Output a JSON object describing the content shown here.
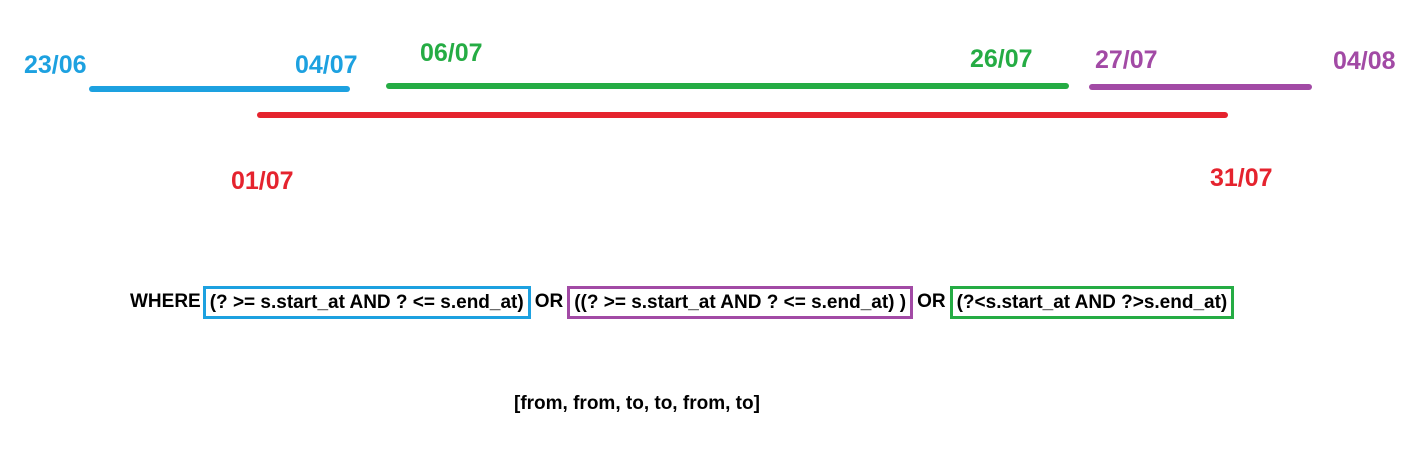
{
  "colors": {
    "blue": "#1da1e0",
    "green": "#25ac44",
    "purple": "#a24aa5",
    "red": "#e5232e",
    "text": "#000000"
  },
  "ranges": {
    "blue": {
      "start": "23/06",
      "end": "04/07"
    },
    "green": {
      "start": "06/07",
      "end": "26/07"
    },
    "purple": {
      "start": "27/07",
      "end": "04/08"
    },
    "red": {
      "start": "01/07",
      "end": "31/07"
    }
  },
  "query": {
    "prefix": "WHERE",
    "clause_blue": "(? >= s.start_at AND ? <= s.end_at)",
    "or_1": "OR",
    "clause_purple": "((? >= s.start_at AND ? <= s.end_at) )",
    "or_2": "OR",
    "clause_green": "(?<s.start_at AND ?>s.end_at)"
  },
  "params": "[from, from, to, to, from, to]"
}
